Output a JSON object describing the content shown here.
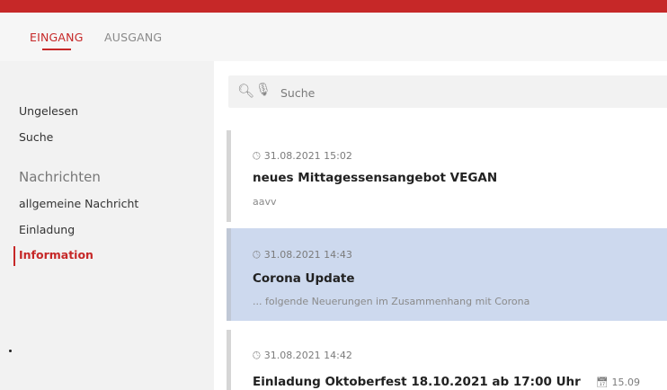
{
  "tabs": [
    {
      "label": "EINGANG",
      "active": true
    },
    {
      "label": "AUSGANG",
      "active": false
    }
  ],
  "sidebar": {
    "items": [
      {
        "label": "Ungelesen"
      },
      {
        "label": "Suche"
      }
    ],
    "section_title": "Nachrichten",
    "categories": [
      {
        "label": "allgemeine Nachricht"
      },
      {
        "label": "Einladung"
      },
      {
        "label": "Information",
        "active": true
      }
    ]
  },
  "search": {
    "placeholder": "Suche"
  },
  "messages": [
    {
      "date": "31.08.2021 15:02",
      "title": "neues Mittagessensangebot VEGAN",
      "preview": "aavv"
    },
    {
      "date": "31.08.2021 14:43",
      "title": "Corona Update",
      "preview": "... folgende Neuerungen im Zusammenhang mit Corona",
      "selected": true
    },
    {
      "date": "31.08.2021 14:42",
      "title": "Einladung Oktoberfest 18.10.2021 ab 17:00 Uhr",
      "side_date": "15.09"
    }
  ],
  "colors": {
    "accent": "#c62828",
    "selected_bg": "#cdd9ee",
    "sidebar_bg": "#f2f2f2"
  }
}
